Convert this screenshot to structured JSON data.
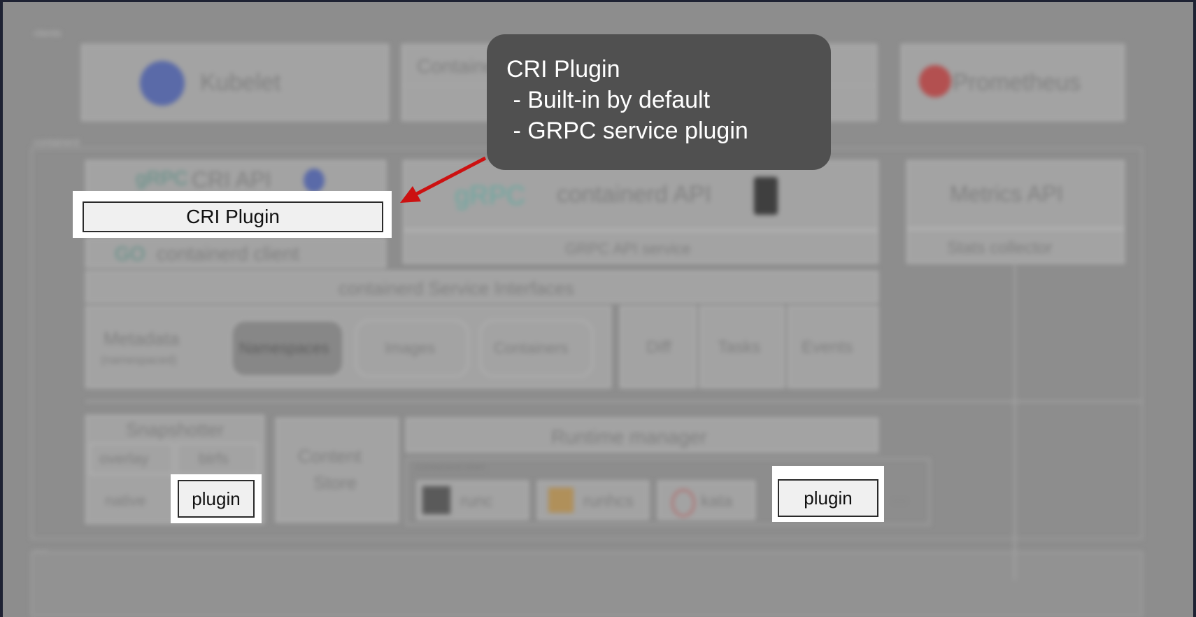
{
  "background_labels": {
    "clients": "clients",
    "containerd": "containerd",
    "os": "OS"
  },
  "clients": {
    "kubelet": "Kubelet",
    "containerd_ctl": "Containerd",
    "prometheus": "Prometheus"
  },
  "containerd": {
    "cri_api": "CRI API",
    "containerd_client": "containerd client",
    "containerd_api": "containerd API",
    "grpc_api_service": "GRPC API service",
    "metrics_api": "Metrics API",
    "stats_collector": "Stats collector",
    "service_interfaces": "containerd Service Interfaces",
    "metadata": "Metadata",
    "metadata_sub": "(namespaced)",
    "namespaces": "Namespaces",
    "images": "Images",
    "containers": "Containers",
    "diff": "Diff",
    "tasks": "Tasks",
    "events": "Events",
    "snapshotter": "Snapshotter",
    "overlay": "overlay",
    "btrfs": "btrfs",
    "native": "native",
    "content_store_line1": "Content",
    "content_store_line2": "Store",
    "runtime_manager": "Runtime manager",
    "containerd_shim": "containerd-shim",
    "runc": "runc",
    "runhcs": "runhcs",
    "kata": "kata",
    "more": "..."
  },
  "highlights": {
    "cri_plugin": "CRI Plugin",
    "snapshot_plugin": "plugin",
    "runtime_plugin": "plugin"
  },
  "callout": {
    "text": "CRI Plugin\n - Built-in by default\n - GRPC service plugin"
  },
  "colors": {
    "callout_bg": "#505050",
    "arrow": "#cc1111",
    "page_bg": "#8d8d8d"
  }
}
